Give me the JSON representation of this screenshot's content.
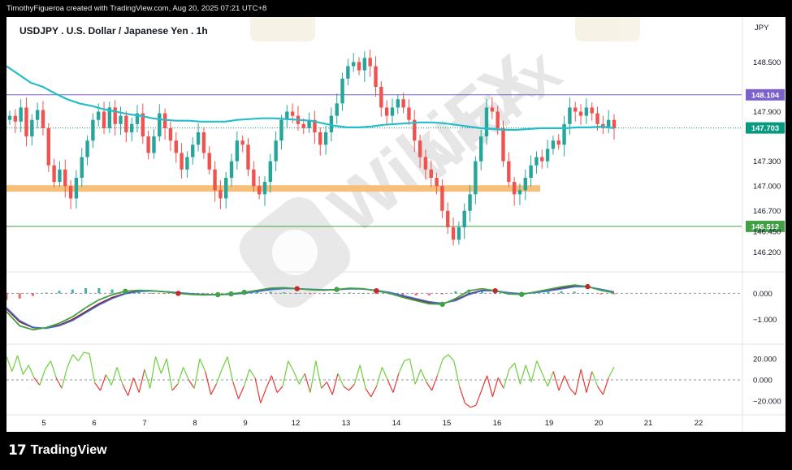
{
  "header": {
    "attribution": "TimothyFigueroa created with TradingView.com, Aug 20, 2025 07:21 UTC+8"
  },
  "footer": {
    "logo_mark": "17",
    "logo_text": "TradingView"
  },
  "watermark": {
    "text": "WikiFX"
  },
  "chart_data": [
    {
      "type": "line",
      "panel": "price",
      "title": "USDJPY . U.S. Dollar / Japanese Yen . 1h",
      "currency": "JPY",
      "x_ticks": [
        "5",
        "6",
        "7",
        "8",
        "9",
        "12",
        "13",
        "14",
        "15",
        "15",
        "16",
        "19",
        "20",
        "21",
        "22"
      ],
      "y_ticks": [
        148.5,
        147.9,
        147.3,
        147.0,
        146.7,
        146.45,
        146.2
      ],
      "y_tick_labels": [
        "148.500",
        "147.900",
        "147.300",
        "147.000",
        "146.700",
        "146.450",
        "146.200"
      ],
      "ylim": [
        146.0,
        148.75
      ],
      "horizontal_levels": [
        {
          "label": "148.104",
          "value": 148.104,
          "color": "#7b61c9",
          "style": "line"
        },
        {
          "label": "146.512",
          "value": 146.512,
          "color": "#43a047",
          "style": "line"
        },
        {
          "label": "147.703",
          "value": 147.703,
          "color": "#089981",
          "style": "dotted-last-price"
        }
      ],
      "support_zone": {
        "value": 146.97,
        "color": "#f7c07a"
      },
      "series": [
        {
          "kind": "candlestick",
          "up_color": "#26a69a",
          "down_color": "#ef5350",
          "close": [
            147.85,
            147.78,
            147.95,
            147.6,
            147.8,
            147.92,
            147.7,
            147.25,
            147.05,
            147.2,
            147.0,
            146.85,
            147.1,
            147.35,
            147.55,
            147.8,
            147.9,
            147.7,
            147.95,
            147.75,
            147.85,
            147.65,
            147.75,
            147.88,
            147.6,
            147.4,
            147.6,
            147.88,
            147.7,
            147.55,
            147.4,
            147.2,
            147.35,
            147.5,
            147.65,
            147.4,
            147.2,
            146.95,
            146.85,
            147.1,
            147.3,
            147.55,
            147.5,
            147.2,
            147.0,
            146.9,
            147.05,
            147.3,
            147.55,
            147.8,
            147.9,
            147.85,
            147.75,
            147.7,
            147.8,
            147.65,
            147.5,
            147.65,
            147.85,
            148.0,
            148.3,
            148.45,
            148.5,
            148.4,
            148.55,
            148.45,
            148.2,
            147.95,
            147.85,
            147.95,
            148.05,
            147.95,
            147.8,
            147.55,
            147.35,
            147.2,
            147.1,
            147.0,
            146.7,
            146.5,
            146.35,
            146.5,
            146.7,
            146.9,
            147.3,
            147.6,
            147.95,
            147.9,
            147.7,
            147.3,
            147.05,
            146.9,
            146.95,
            147.1,
            147.25,
            147.35,
            147.3,
            147.45,
            147.55,
            147.5,
            147.75,
            147.95,
            147.9,
            147.85,
            147.95,
            147.88,
            147.75,
            147.7,
            147.8,
            147.7
          ]
        },
        {
          "kind": "moving-average",
          "color": "#26bcc8",
          "values": [
            148.45,
            148.35,
            148.25,
            148.2,
            148.12,
            148.05,
            148.0,
            147.97,
            147.93,
            147.9,
            147.87,
            147.85,
            147.82,
            147.8,
            147.79,
            147.79,
            147.78,
            147.78,
            147.78,
            147.8,
            147.81,
            147.82,
            147.82,
            147.81,
            147.8,
            147.79,
            147.76,
            147.73,
            147.71,
            147.71,
            147.72,
            147.74,
            147.75,
            147.76,
            147.77,
            147.77,
            147.76,
            147.74,
            147.72,
            147.7,
            147.69,
            147.68,
            147.68,
            147.69,
            147.7,
            147.7,
            147.7,
            147.71,
            147.71,
            147.72,
            147.7
          ]
        }
      ]
    },
    {
      "type": "line",
      "panel": "macd",
      "y_ticks": [
        0.0,
        -1.0
      ],
      "y_tick_labels": [
        "0.000",
        "−1.000"
      ],
      "ylim": [
        -1.8,
        0.7
      ],
      "series": [
        {
          "kind": "line",
          "color": "#43a047",
          "values": [
            -0.7,
            -1.25,
            -1.4,
            -1.32,
            -1.15,
            -0.9,
            -0.55,
            -0.25,
            -0.05,
            0.08,
            0.12,
            0.1,
            0.06,
            0.0,
            -0.04,
            -0.06,
            -0.05,
            -0.02,
            0.04,
            0.12,
            0.2,
            0.22,
            0.18,
            0.14,
            0.12,
            0.15,
            0.2,
            0.18,
            0.1,
            0.0,
            -0.15,
            -0.28,
            -0.4,
            -0.42,
            -0.2,
            0.1,
            0.18,
            0.1,
            -0.02,
            -0.04,
            0.05,
            0.15,
            0.25,
            0.32,
            0.26,
            0.12,
            0.02
          ]
        },
        {
          "kind": "line",
          "color": "#3f6fe0",
          "values": [
            -0.55,
            -1.05,
            -1.3,
            -1.35,
            -1.25,
            -1.05,
            -0.75,
            -0.45,
            -0.2,
            -0.02,
            0.07,
            0.09,
            0.07,
            0.03,
            -0.01,
            -0.04,
            -0.05,
            -0.04,
            0.0,
            0.07,
            0.14,
            0.18,
            0.18,
            0.16,
            0.14,
            0.14,
            0.17,
            0.17,
            0.12,
            0.04,
            -0.08,
            -0.2,
            -0.32,
            -0.38,
            -0.28,
            -0.05,
            0.1,
            0.1,
            0.03,
            -0.01,
            0.02,
            0.09,
            0.17,
            0.25,
            0.25,
            0.16,
            0.06
          ]
        },
        {
          "kind": "signal-overlay",
          "color": "#8b1a1a",
          "values": [
            -0.6,
            -1.1,
            -1.32,
            -1.34,
            -1.22,
            -1.0,
            -0.7,
            -0.4,
            -0.16,
            0.0,
            0.09,
            0.1,
            0.07,
            0.02,
            -0.02,
            -0.05,
            -0.05,
            -0.03,
            0.02,
            0.09,
            0.16,
            0.2,
            0.18,
            0.15,
            0.13,
            0.14,
            0.18,
            0.17,
            0.11,
            0.02,
            -0.11,
            -0.24,
            -0.36,
            -0.4,
            -0.25,
            -0.02,
            0.12,
            0.1,
            0.01,
            -0.02,
            0.03,
            0.11,
            0.2,
            0.28,
            0.26,
            0.14,
            0.04
          ]
        },
        {
          "kind": "histogram",
          "color_pos": "#26a69a",
          "color_neg": "#ef5350",
          "values": [
            -0.25,
            -0.2,
            -0.1,
            0.03,
            0.1,
            0.15,
            0.2,
            0.2,
            0.15,
            0.1,
            0.05,
            0.01,
            -0.01,
            -0.03,
            -0.03,
            -0.02,
            0.0,
            0.02,
            0.04,
            0.05,
            0.06,
            0.04,
            0.0,
            -0.02,
            -0.02,
            0.01,
            0.03,
            0.01,
            -0.02,
            -0.04,
            -0.07,
            -0.08,
            -0.08,
            -0.04,
            0.08,
            0.15,
            0.08,
            0.0,
            -0.05,
            -0.03,
            0.03,
            0.06,
            0.08,
            0.07,
            0.01,
            -0.04,
            -0.04
          ]
        }
      ],
      "cross_markers": [
        {
          "i": 9,
          "color": "#43a047"
        },
        {
          "i": 13,
          "color": "#c62828"
        },
        {
          "i": 16,
          "color": "#43a047"
        },
        {
          "i": 17,
          "color": "#43a047"
        },
        {
          "i": 18,
          "color": "#43a047"
        },
        {
          "i": 22,
          "color": "#c62828"
        },
        {
          "i": 25,
          "color": "#43a047"
        },
        {
          "i": 28,
          "color": "#c62828"
        },
        {
          "i": 33,
          "color": "#43a047"
        },
        {
          "i": 37,
          "color": "#c62828"
        },
        {
          "i": 39,
          "color": "#43a047"
        },
        {
          "i": 44,
          "color": "#c62828"
        }
      ]
    },
    {
      "type": "line",
      "panel": "oscillator",
      "y_ticks": [
        20.0,
        0.0,
        -20.0
      ],
      "y_tick_labels": [
        "20.000",
        "0.000",
        "−20.000"
      ],
      "ylim": [
        -30,
        30
      ],
      "series": [
        {
          "kind": "line",
          "color_pos": "#6ccf3c",
          "color_neg": "#e53935",
          "values": [
            22,
            8,
            23,
            5,
            14,
            2,
            -5,
            10,
            18,
            2,
            -8,
            12,
            24,
            18,
            26,
            25,
            -3,
            -10,
            5,
            -5,
            12,
            -4,
            -15,
            2,
            -12,
            10,
            -8,
            22,
            6,
            20,
            -10,
            -4,
            12,
            0,
            -8,
            20,
            8,
            -14,
            -4,
            10,
            22,
            -2,
            -18,
            -6,
            10,
            2,
            -22,
            -8,
            4,
            -12,
            -6,
            18,
            8,
            -4,
            6,
            -12,
            18,
            -8,
            -2,
            -14,
            6,
            -6,
            -10,
            -4,
            14,
            -8,
            -16,
            -6,
            12,
            0,
            -12,
            6,
            18,
            20,
            -4,
            10,
            -2,
            -10,
            4,
            20,
            24,
            18,
            -6,
            -22,
            -26,
            -24,
            -10,
            4,
            -16,
            2,
            -8,
            10,
            16,
            -4,
            14,
            -2,
            18,
            6,
            -6,
            8,
            -10,
            4,
            -8,
            -14,
            10,
            -12,
            8,
            -6,
            -14,
            2,
            12
          ]
        }
      ]
    }
  ]
}
